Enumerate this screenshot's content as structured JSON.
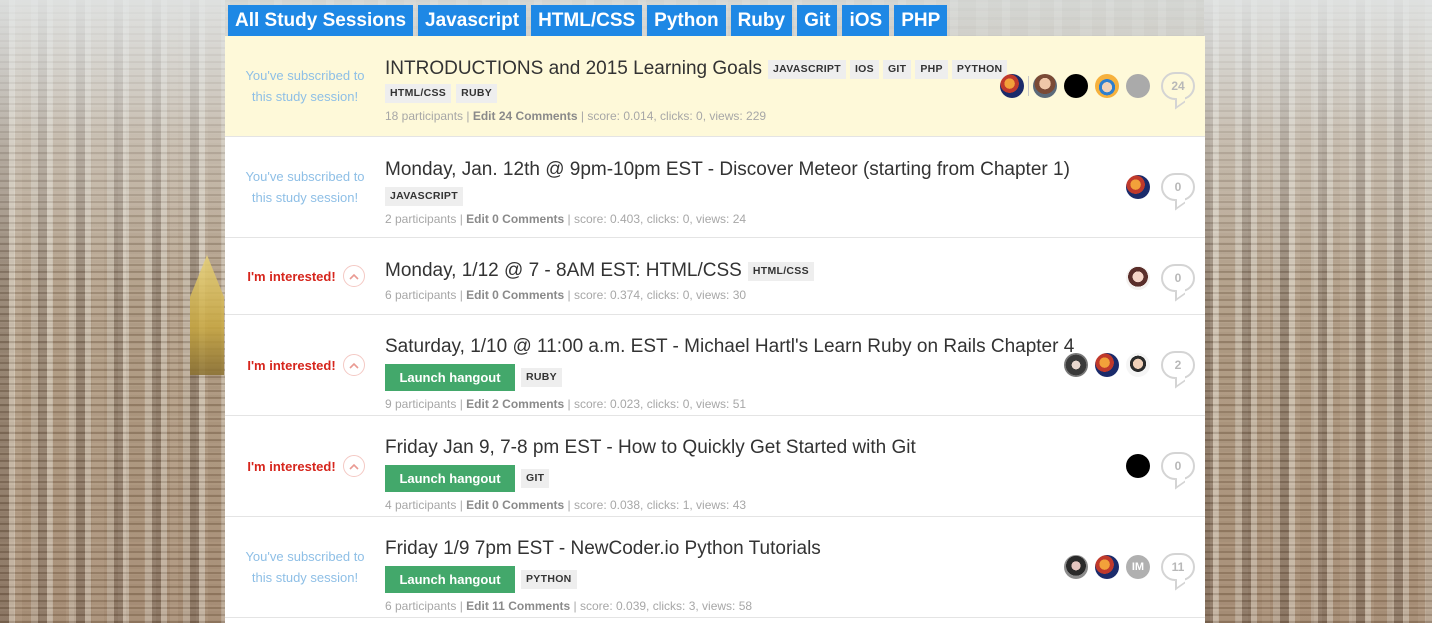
{
  "tabs": [
    "All Study Sessions",
    "Javascript",
    "HTML/CSS",
    "Python",
    "Ruby",
    "Git",
    "iOS",
    "PHP"
  ],
  "subscribed_text": "You've subscribed to this study session!",
  "interested_text": "I'm interested!",
  "launch_label": "Launch hangout",
  "meta_labels": {
    "participants": "participants",
    "edit": "Edit",
    "comments": "Comments",
    "score": "score:",
    "clicks": "clicks:",
    "views": "views:"
  },
  "sessions": [
    {
      "title": "INTRODUCTIONS and 2015 Learning Goals",
      "status": "subscribed",
      "tags_inline": [
        "JAVASCRIPT",
        "IOS",
        "GIT",
        "PHP",
        "PYTHON"
      ],
      "tags_below": [
        "HTML/CSS",
        "RUBY"
      ],
      "launch": false,
      "participants": "18",
      "comments": "24",
      "score": "0.014",
      "clicks": "0",
      "views": "229",
      "avatars": [
        "av-a",
        "divider",
        "av-b",
        "av-c",
        "av-d",
        "av-e"
      ],
      "comment_count": "24"
    },
    {
      "title": "Monday, Jan. 12th @ 9pm-10pm EST - Discover Meteor (starting from Chapter 1)",
      "status": "subscribed",
      "tags_inline": [],
      "tags_below": [
        "JAVASCRIPT"
      ],
      "launch": false,
      "participants": "2",
      "comments": "0",
      "score": "0.403",
      "clicks": "0",
      "views": "24",
      "avatars": [
        "av-a"
      ],
      "comment_count": "0"
    },
    {
      "title": "Monday, 1/12 @ 7 - 8AM EST: HTML/CSS",
      "status": "interested",
      "tags_inline": [
        "HTML/CSS"
      ],
      "tags_below": [],
      "launch": false,
      "participants": "6",
      "comments": "0",
      "score": "0.374",
      "clicks": "0",
      "views": "30",
      "avatars": [
        "av-f"
      ],
      "comment_count": "0"
    },
    {
      "title": "Saturday, 1/10 @ 11:00 a.m. EST - Michael Hartl's Learn Ruby on Rails Chapter 4",
      "status": "interested",
      "tags_inline": [],
      "tags_below": [
        "RUBY"
      ],
      "launch": true,
      "participants": "9",
      "comments": "2",
      "score": "0.023",
      "clicks": "0",
      "views": "51",
      "avatars": [
        "av-g",
        "av-a",
        "av-h"
      ],
      "comment_count": "2"
    },
    {
      "title": "Friday Jan 9, 7-8 pm EST - How to Quickly Get Started with Git",
      "status": "interested",
      "tags_inline": [],
      "tags_below": [
        "GIT"
      ],
      "launch": true,
      "participants": "4",
      "comments": "0",
      "score": "0.038",
      "clicks": "1",
      "views": "43",
      "avatars": [
        "av-c"
      ],
      "comment_count": "0"
    },
    {
      "title": "Friday 1/9 7pm EST - NewCoder.io Python Tutorials",
      "status": "subscribed",
      "tags_inline": [],
      "tags_below": [
        "PYTHON"
      ],
      "launch": true,
      "participants": "6",
      "comments": "11",
      "score": "0.039",
      "clicks": "3",
      "views": "58",
      "avatars": [
        "av-i",
        "av-a",
        "av-j:IM"
      ],
      "comment_count": "11"
    }
  ],
  "colors": {
    "tab_blue": "#1e88e5",
    "launch_green": "#43a86b",
    "interested_red": "#d6251c",
    "subscribed_blue": "#8ebfe6",
    "highlight_row": "#fef9d9"
  },
  "icons": {
    "upvote": "chevron-up-icon",
    "comments": "speech-bubble-icon"
  }
}
